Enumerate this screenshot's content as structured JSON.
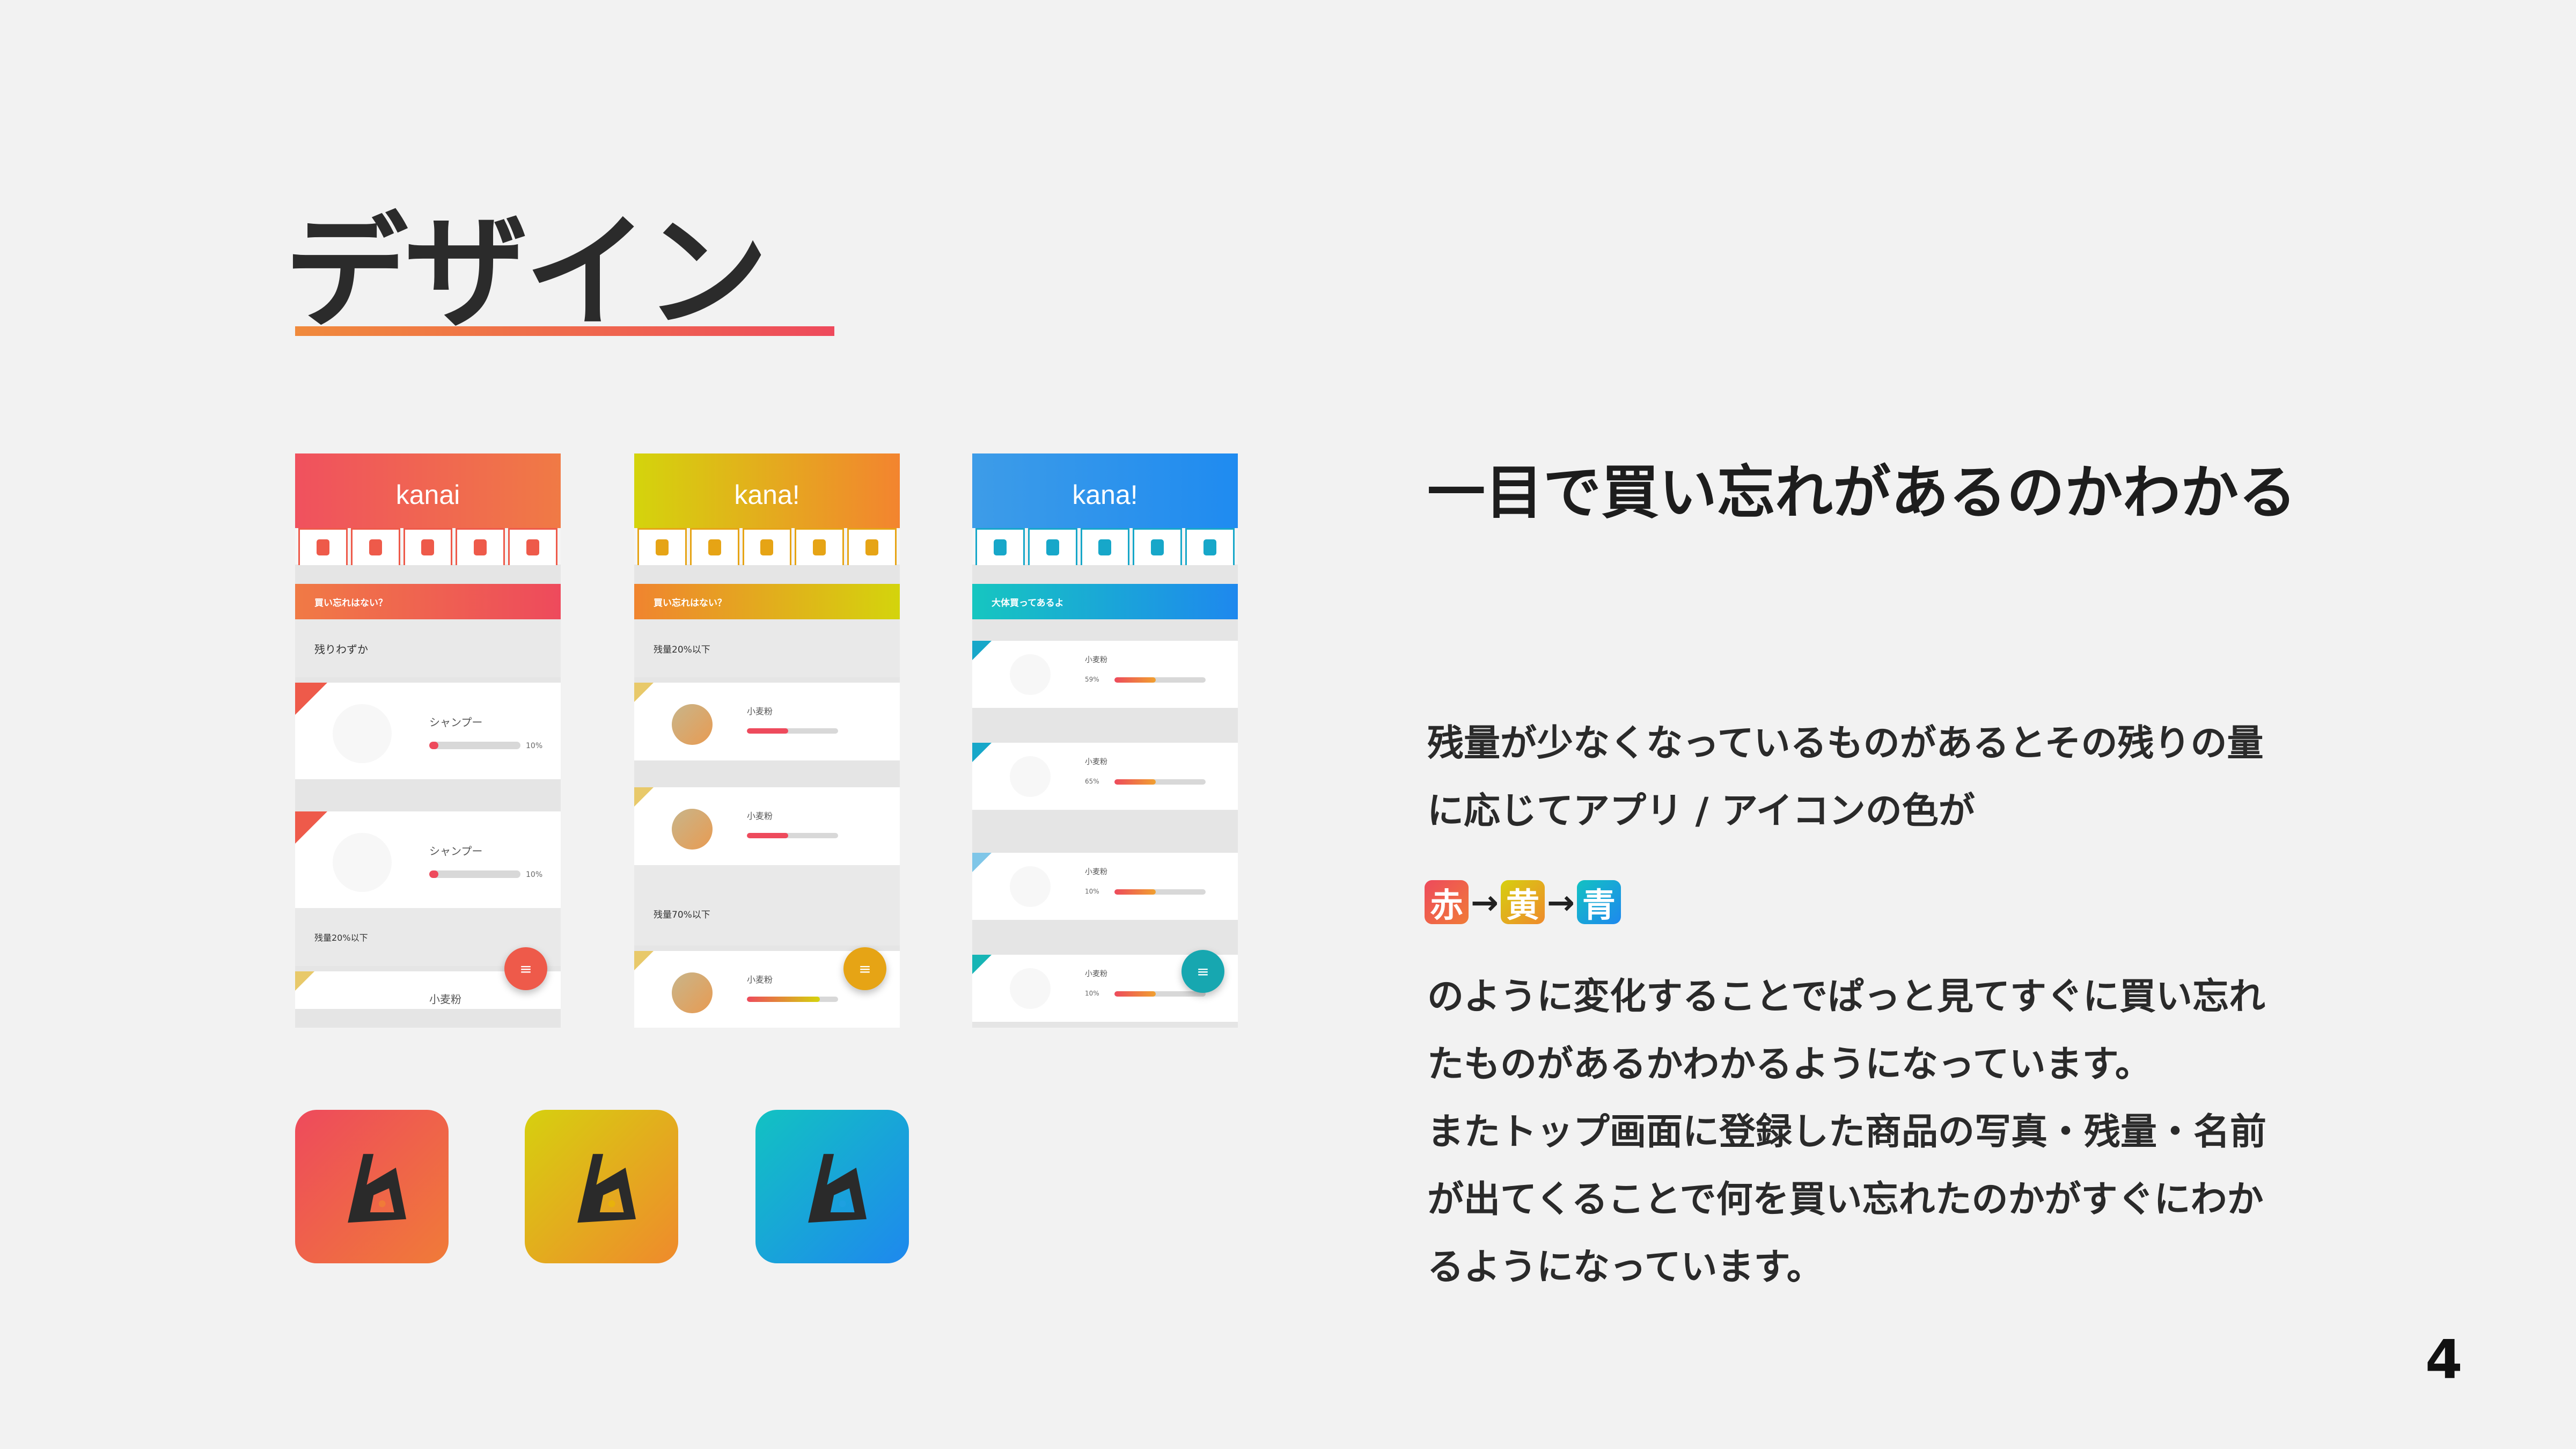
{
  "slide": {
    "title": "デザイン",
    "page_number": "4"
  },
  "phones": [
    {
      "theme": "red",
      "logo": "kanai",
      "header_gradient": [
        "#f0515e",
        "#f07a45"
      ],
      "accent": "#ee4a5c",
      "banner": "買い忘れはない？",
      "section1": "残りわずか",
      "items": [
        {
          "name": "シャンプー",
          "pct": "10%",
          "level": 0.1
        },
        {
          "name": "シャンプー",
          "pct": "10%",
          "level": 0.1
        }
      ],
      "section2": "残量20%以下",
      "item3": "小麦粉",
      "fab": "≡"
    },
    {
      "theme": "yellow",
      "logo": "kana!",
      "header_gradient": [
        "#d4d40c",
        "#f3842f"
      ],
      "accent": "#e6a415",
      "banner": "買い忘れはない？",
      "section1": "残量20%以下",
      "items": [
        {
          "name": "小麦粉",
          "level": 0.45
        },
        {
          "name": "小麦粉",
          "level": 0.45
        }
      ],
      "section2": "残量70%以下",
      "item3": "小麦粉",
      "fab": "≡"
    },
    {
      "theme": "blue",
      "logo": "kana!",
      "header_gradient": [
        "#3d9ce8",
        "#1f8bf0"
      ],
      "accent": "#17a7c9",
      "banner": "大体買ってあるよ",
      "items": [
        {
          "name": "小麦粉",
          "pct": "59%",
          "level": 0.45
        },
        {
          "name": "小麦粉",
          "pct": "65%",
          "level": 0.45
        },
        {
          "name": "小麦粉",
          "pct": "10%",
          "level": 0.45
        },
        {
          "name": "小麦粉",
          "pct": "10%",
          "level": 0.45
        }
      ],
      "fab": "≡"
    }
  ],
  "app_icons": [
    {
      "name": "red",
      "gradient": [
        "#ee4a5c",
        "#f07b38"
      ]
    },
    {
      "name": "yellow",
      "gradient": [
        "#d6d00f",
        "#ef8a2c"
      ]
    },
    {
      "name": "blue",
      "gradient": [
        "#12c2c2",
        "#1e88ee"
      ]
    }
  ],
  "text": {
    "headline": "一目で買い忘れがあるのかわかる",
    "para1_line1": "残量が少なくなっているものがあるとその残りの量",
    "para1_line2": "に応じてアプリ / アイコンの色が",
    "chip_red": "赤",
    "chip_yellow": "黄",
    "chip_blue": "青",
    "arrow": "→",
    "para2_line1": "のように変化することでぱっと見てすぐに買い忘れ",
    "para2_line2": "たものがあるかわかるようになっています。",
    "para2_line3": "またトップ画面に登録した商品の写真・残量・名前",
    "para2_line4": "が出てくることで何を買い忘れたのかがすぐにわか",
    "para2_line5": "るようになっています。"
  },
  "colors": {
    "red": "#ee5a4a",
    "yellow": "#e8b20c",
    "blue": "#1ea0e0"
  }
}
